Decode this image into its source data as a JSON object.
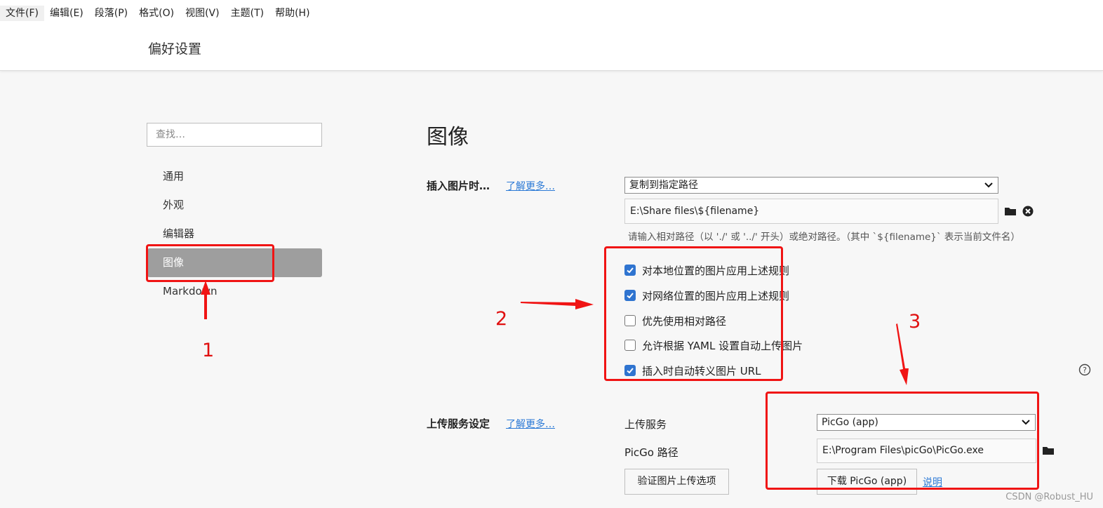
{
  "menu": [
    "文件(F)",
    "编辑(E)",
    "段落(P)",
    "格式(O)",
    "视图(V)",
    "主题(T)",
    "帮助(H)"
  ],
  "window": {
    "title": "偏好设置"
  },
  "search": {
    "placeholder": "查找…"
  },
  "nav": {
    "items": [
      "通用",
      "外观",
      "编辑器",
      "图像",
      "Markdown"
    ],
    "active": "图像"
  },
  "section": {
    "title": "图像"
  },
  "insert": {
    "label": "插入图片时…",
    "learn_more": "了解更多…",
    "select_value": "复制到指定路径",
    "path_value": "E:\\Share files\\${filename}",
    "hint": "请输入相对路径（以 './' 或 '../' 开头）或绝对路径。（其中 `${filename}` 表示当前文件名）",
    "options": [
      {
        "label": "对本地位置的图片应用上述规则",
        "checked": true
      },
      {
        "label": "对网络位置的图片应用上述规则",
        "checked": true
      },
      {
        "label": "优先使用相对路径",
        "checked": false
      },
      {
        "label": "允许根据 YAML 设置自动上传图片",
        "checked": false
      },
      {
        "label": "插入时自动转义图片 URL",
        "checked": true
      }
    ]
  },
  "upload": {
    "label": "上传服务设定",
    "learn_more": "了解更多…",
    "service_label": "上传服务",
    "service_value": "PicGo (app)",
    "path_label": "PicGo 路径",
    "path_value": "E:\\Program Files\\picGo\\PicGo.exe",
    "verify_button": "验证图片上传选项",
    "download_button": "下载 PicGo (app)",
    "explain_link": "说明"
  },
  "annotations": {
    "labels": [
      "1",
      "2",
      "3"
    ],
    "color": "#f01414"
  },
  "watermark": "CSDN @Robust_HU",
  "colors": {
    "accent": "#2f74d0",
    "link": "#2c7ad6",
    "active_nav": "#9e9e9e"
  }
}
